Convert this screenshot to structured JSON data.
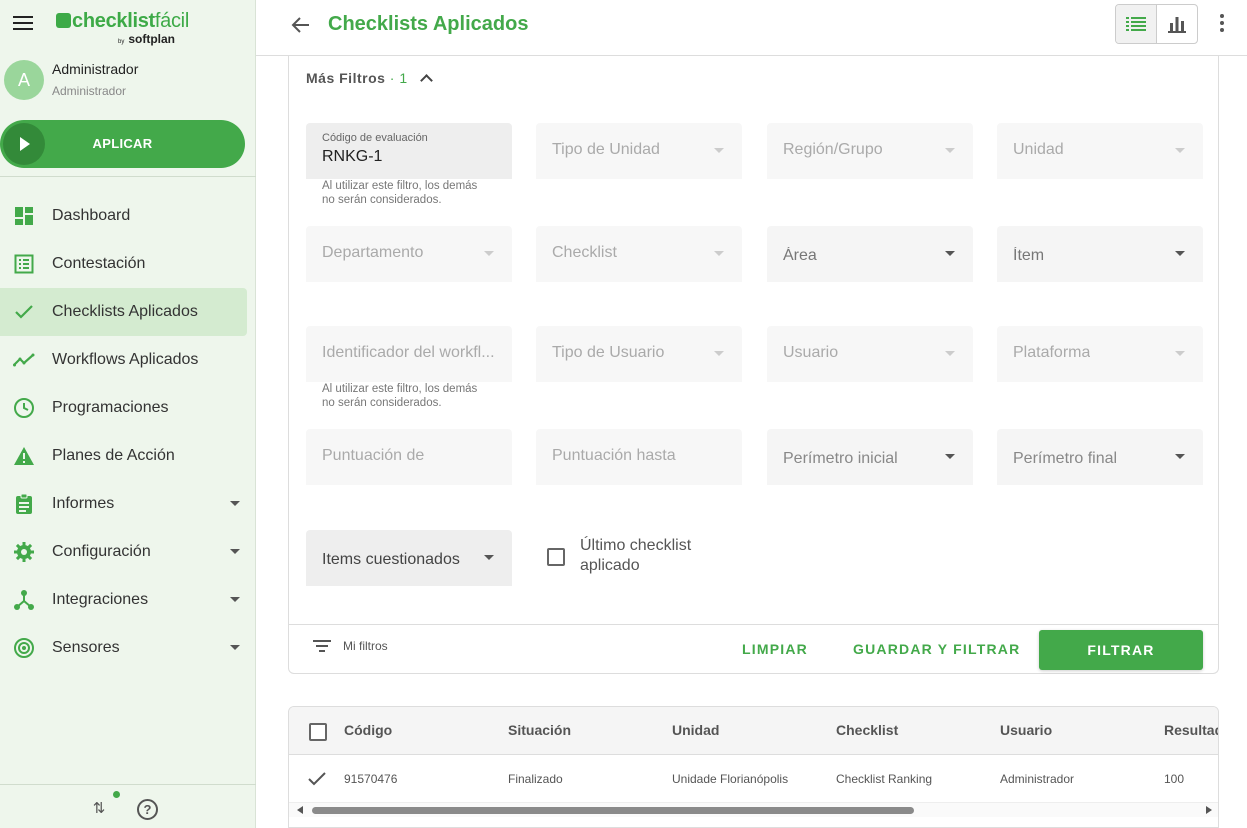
{
  "sidebar": {
    "logo_main": "checklist",
    "logo_main_light": "fácil",
    "logo_by": "by",
    "logo_brand": "softplan",
    "avatar_letter": "A",
    "user_name": "Administrador",
    "user_role": "Administrador",
    "apply_label": "APLICAR",
    "items": [
      {
        "label": "Dashboard",
        "icon": "dashboard-icon"
      },
      {
        "label": "Contestación",
        "icon": "list-alt-icon"
      },
      {
        "label": "Checklists Aplicados",
        "icon": "check-icon",
        "active": true
      },
      {
        "label": "Workflows Aplicados",
        "icon": "trending-icon"
      },
      {
        "label": "Programaciones",
        "icon": "clock-icon"
      },
      {
        "label": "Planes de Acción",
        "icon": "warning-icon"
      },
      {
        "label": "Informes",
        "icon": "clipboard-icon",
        "expandable": true
      },
      {
        "label": "Configuración",
        "icon": "gear-icon",
        "expandable": true
      },
      {
        "label": "Integraciones",
        "icon": "hub-icon",
        "expandable": true
      },
      {
        "label": "Sensores",
        "icon": "sensor-icon",
        "expandable": true
      }
    ],
    "help_glyph": "?",
    "sync_glyph": "⇅"
  },
  "header": {
    "title": "Checklists Aplicados"
  },
  "filters": {
    "more_filters_label": "Más Filtros",
    "more_filters_sep": " · ",
    "more_filters_count": "1",
    "eval_code_label": "Código de evaluación",
    "eval_code_value": "RNKG-1",
    "hint_text": "Al utilizar este filtro, los demás no serán considerados.",
    "tipo_unidad": "Tipo de Unidad",
    "region_grupo": "Región/Grupo",
    "unidad": "Unidad",
    "departamento": "Departamento",
    "checklist": "Checklist",
    "area": "Área",
    "item": "Ítem",
    "identificador_workflow": "Identificador del workfl...",
    "tipo_usuario": "Tipo de Usuario",
    "usuario": "Usuario",
    "plataforma": "Plataforma",
    "puntuacion_de": "Puntuación de",
    "puntuacion_hasta": "Puntuación hasta",
    "perimetro_inicial": "Perímetro inicial",
    "perimetro_final": "Perímetro final",
    "items_cuestionados": "Items cuestionados",
    "ultimo_checklist_line1": "Último checklist",
    "ultimo_checklist_line2": "aplicado",
    "mis_filtros": "Mi filtros",
    "limpiar": "LIMPIAR",
    "guardar_filtrar": "GUARDAR Y FILTRAR",
    "filtrar": "FILTRAR"
  },
  "table": {
    "columns": [
      "Código",
      "Situación",
      "Unidad",
      "Checklist",
      "Usuario",
      "Resultad"
    ],
    "rows": [
      [
        "91570476",
        "Finalizado",
        "Unidade Florianópolis",
        "Checklist Ranking",
        "Administrador",
        "100"
      ]
    ]
  },
  "colors": {
    "accent": "#43a94a",
    "sidebar_bg": "#eef6ec",
    "active_item_bg": "#d4ebd0"
  }
}
